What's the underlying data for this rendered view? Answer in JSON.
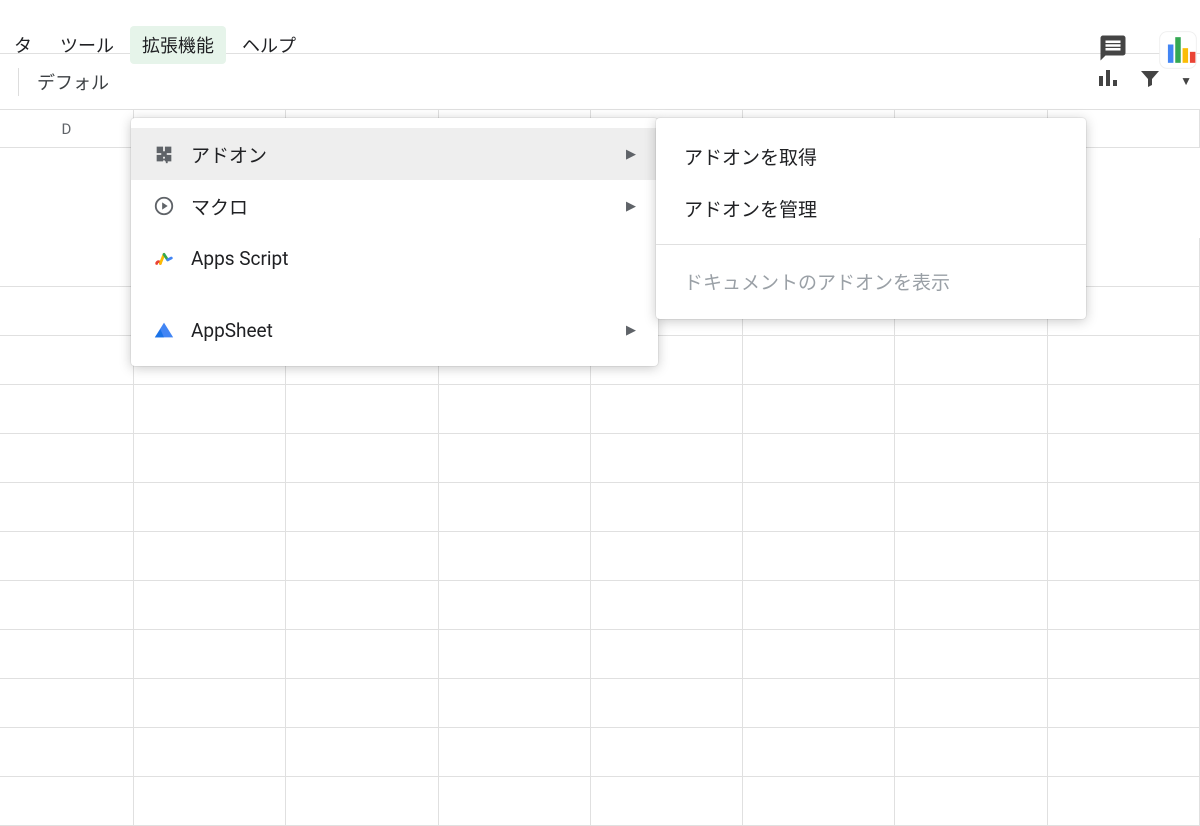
{
  "menubar": {
    "items": [
      "タ",
      "ツール",
      "拡張機能",
      "ヘルプ"
    ],
    "active_index": 2
  },
  "toolbar": {
    "font_label": "デフォル"
  },
  "columns": [
    "D"
  ],
  "dropdown": {
    "items": [
      {
        "label": "アドオン",
        "submenu": true
      },
      {
        "label": "マクロ",
        "submenu": true
      },
      {
        "label": "Apps Script",
        "submenu": false
      },
      {
        "label": "AppSheet",
        "submenu": true
      }
    ],
    "highlighted_index": 0
  },
  "submenu": {
    "items": [
      {
        "label": "アドオンを取得",
        "disabled": false
      },
      {
        "label": "アドオンを管理",
        "disabled": false
      },
      {
        "label": "ドキュメントのアドオンを表示",
        "disabled": true
      }
    ]
  }
}
